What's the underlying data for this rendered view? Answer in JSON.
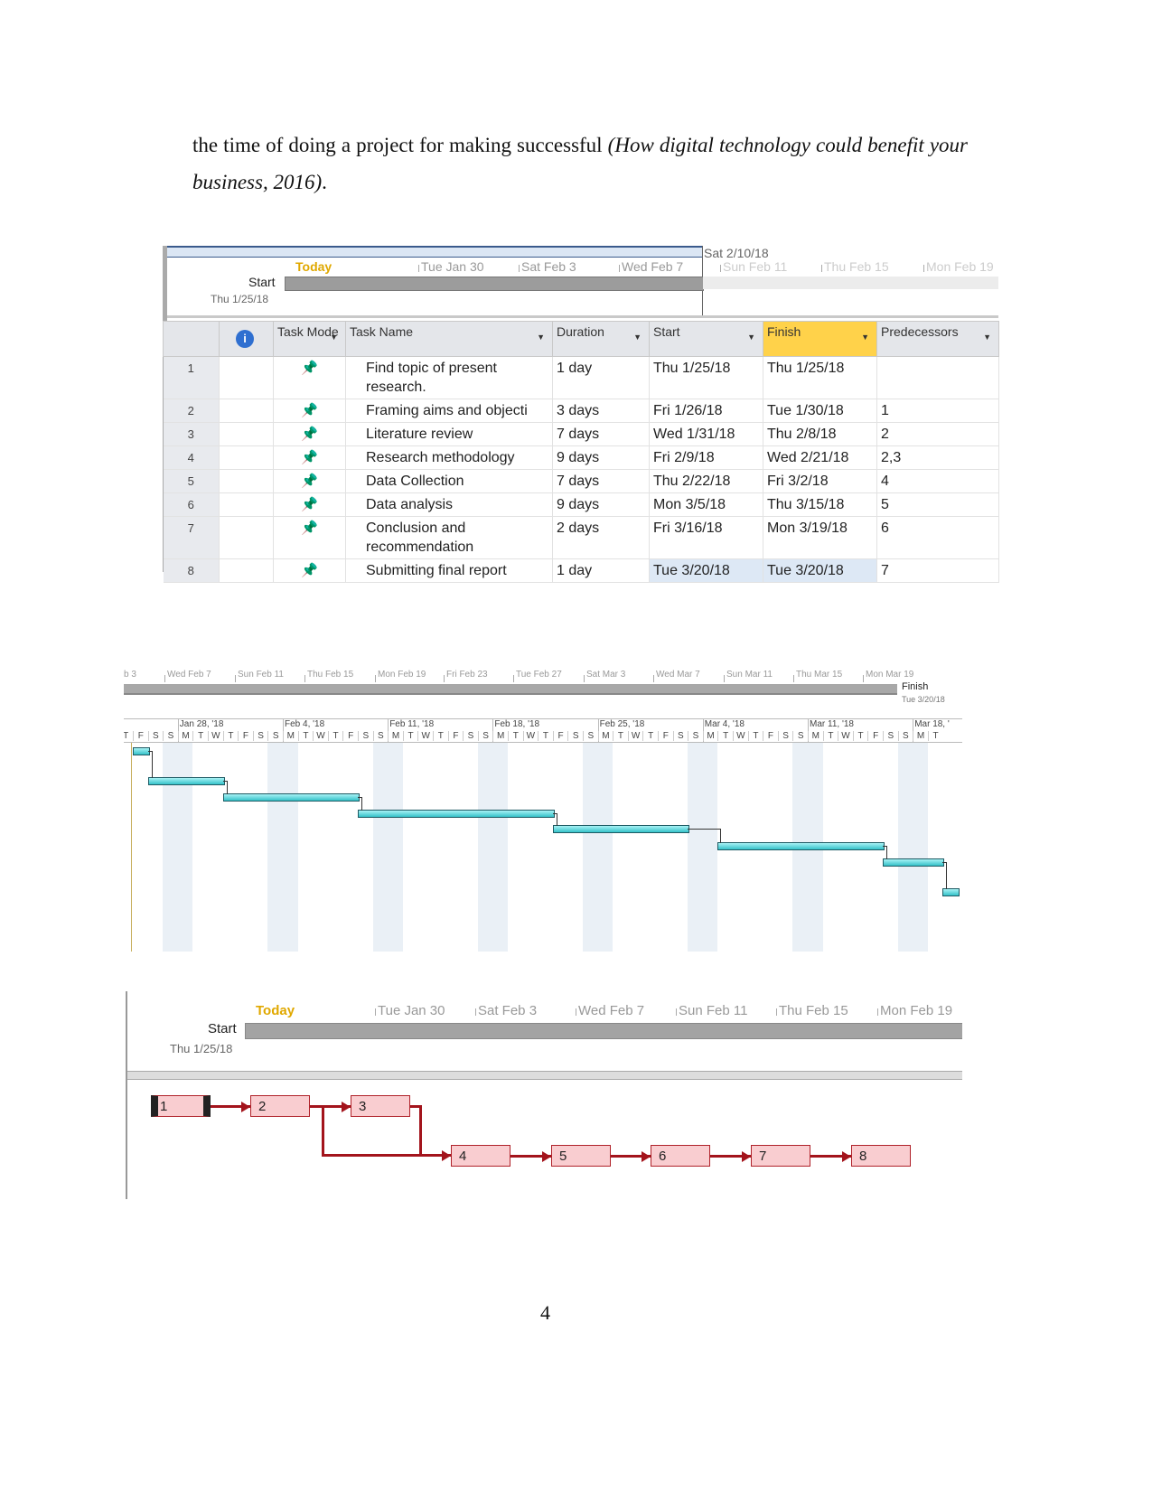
{
  "paragraph": {
    "text": "the time of doing a project for making successful ",
    "citation": "(How digital technology could benefit your business, 2016)",
    "end": "."
  },
  "timeline1": {
    "today": "Today",
    "start_label": "Start",
    "start_date": "Thu 1/25/18",
    "marker": "Sat 2/10/18",
    "ticks": [
      "Tue Jan 30",
      "Sat Feb 3",
      "Wed Feb 7",
      "Sun Feb 11",
      "Thu Feb 15",
      "Mon Feb 19"
    ]
  },
  "table": {
    "headers": [
      "",
      "i",
      "Task Mode",
      "Task Name",
      "Duration",
      "Start",
      "Finish",
      "Predecessors"
    ],
    "rows": [
      {
        "id": "1",
        "name": "Find topic of present research.",
        "duration": "1 day",
        "start": "Thu 1/25/18",
        "finish": "Thu 1/25/18",
        "pred": ""
      },
      {
        "id": "2",
        "name": "Framing aims and objecti",
        "duration": "3 days",
        "start": "Fri 1/26/18",
        "finish": "Tue 1/30/18",
        "pred": "1"
      },
      {
        "id": "3",
        "name": "Literature review",
        "duration": "7 days",
        "start": "Wed 1/31/18",
        "finish": "Thu 2/8/18",
        "pred": "2"
      },
      {
        "id": "4",
        "name": "Research methodology",
        "duration": "9 days",
        "start": "Fri 2/9/18",
        "finish": "Wed 2/21/18",
        "pred": "2,3"
      },
      {
        "id": "5",
        "name": "Data Collection",
        "duration": "7 days",
        "start": "Thu 2/22/18",
        "finish": "Fri 3/2/18",
        "pred": "4"
      },
      {
        "id": "6",
        "name": "Data analysis",
        "duration": "9 days",
        "start": "Mon 3/5/18",
        "finish": "Thu 3/15/18",
        "pred": "5"
      },
      {
        "id": "7",
        "name": "Conclusion and recommendation",
        "duration": "2 days",
        "start": "Fri 3/16/18",
        "finish": "Mon 3/19/18",
        "pred": "6"
      },
      {
        "id": "8",
        "name": "Submitting final report",
        "duration": "1 day",
        "start": "Tue 3/20/18",
        "finish": "Tue 3/20/18",
        "pred": "7"
      }
    ]
  },
  "timeline2": {
    "ticks": [
      "b 3",
      "Wed Feb 7",
      "Sun Feb 11",
      "Thu Feb 15",
      "Mon Feb 19",
      "Fri Feb 23",
      "Tue Feb 27",
      "Sat Mar 3",
      "Wed Mar 7",
      "Sun Mar 11",
      "Thu Mar 15",
      "Mon Mar 19"
    ],
    "finish_label": "Finish",
    "finish_date": "Tue 3/20/18"
  },
  "gantt": {
    "weeks": [
      "Jan 28, '18",
      "Feb 4, '18",
      "Feb 11, '18",
      "Feb 18, '18",
      "Feb 25, '18",
      "Mar 4, '18",
      "Mar 11, '18",
      "Mar 18, '"
    ],
    "day_letters": [
      "W",
      "T",
      "F",
      "S",
      "S",
      "M",
      "T",
      "W",
      "T",
      "F",
      "S",
      "S",
      "M",
      "T",
      "W",
      "T",
      "F",
      "S",
      "S",
      "M",
      "T",
      "W",
      "T",
      "F",
      "S",
      "S",
      "M",
      "T",
      "W",
      "T",
      "F",
      "S",
      "S",
      "M",
      "T",
      "W",
      "T",
      "F",
      "S",
      "S",
      "M",
      "T",
      "W",
      "T",
      "F",
      "S",
      "S",
      "M",
      "T",
      "W",
      "T",
      "F",
      "S",
      "S",
      "M",
      "T"
    ],
    "bar_color": "#34c2c9",
    "bars": [
      {
        "start": "2018-01-25",
        "finish": "2018-01-25"
      },
      {
        "start": "2018-01-26",
        "finish": "2018-01-30"
      },
      {
        "start": "2018-01-31",
        "finish": "2018-02-08"
      },
      {
        "start": "2018-02-09",
        "finish": "2018-02-21"
      },
      {
        "start": "2018-02-22",
        "finish": "2018-03-02"
      },
      {
        "start": "2018-03-05",
        "finish": "2018-03-15"
      },
      {
        "start": "2018-03-16",
        "finish": "2018-03-19"
      },
      {
        "start": "2018-03-20",
        "finish": "2018-03-20"
      }
    ]
  },
  "timeline3": {
    "today": "Today",
    "start_label": "Start",
    "start_date": "Thu 1/25/18",
    "ticks": [
      "Tue Jan 30",
      "Sat Feb 3",
      "Wed Feb 7",
      "Sun Feb 11",
      "Thu Feb 15",
      "Mon Feb 19"
    ]
  },
  "network": {
    "nodes": [
      "1",
      "2",
      "3",
      "4",
      "5",
      "6",
      "7",
      "8"
    ],
    "link_color": "#a3141c",
    "node_fill": "#f9cdd0"
  },
  "page_number": "4"
}
